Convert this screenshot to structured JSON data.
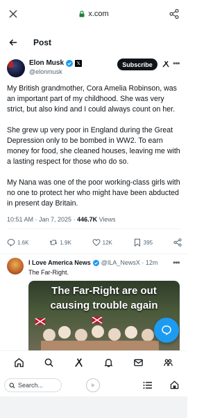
{
  "browser": {
    "url": "x.com",
    "close_icon": "close-icon",
    "share_icon": "share-icon"
  },
  "header": {
    "title": "Post",
    "back_icon": "arrow-left-icon"
  },
  "author": {
    "name": "Elon Musk",
    "handle": "@elonmusk",
    "subscribe_label": "Subscribe"
  },
  "tweet": {
    "paragraphs": [
      "My British grandmother, Cora Amelia Robinson, was an important part of my childhood. She was very strict, but also kind and I could always count on her.",
      "She grew up very poor in England during the Great Depression only to be bombed in WW2. To earn money for food, she cleaned houses, leaving me with a lasting respect for those who do so.",
      "My Nana was one of the poor working-class girls with no one to protect her who might have been abducted in present day Britain."
    ],
    "timestamp": "10:51 AM · Jan 7, 2025 · ",
    "views_count": "446.7K",
    "views_label": " Views"
  },
  "actions": {
    "replies": "1.6K",
    "reposts": "1.9K",
    "likes": "12K",
    "bookmarks": "395"
  },
  "reply": {
    "name": "I Love America News",
    "handle": "@ILA_NewsX · 12m",
    "text": "The Far-Right.",
    "image_line1": "The Far-Right are out",
    "image_line2": "causing trouble again"
  },
  "bottom_browser": {
    "search_placeholder": "Search..."
  },
  "colors": {
    "accent": "#1d9bf0",
    "text": "#0f1419",
    "muted": "#536471"
  }
}
